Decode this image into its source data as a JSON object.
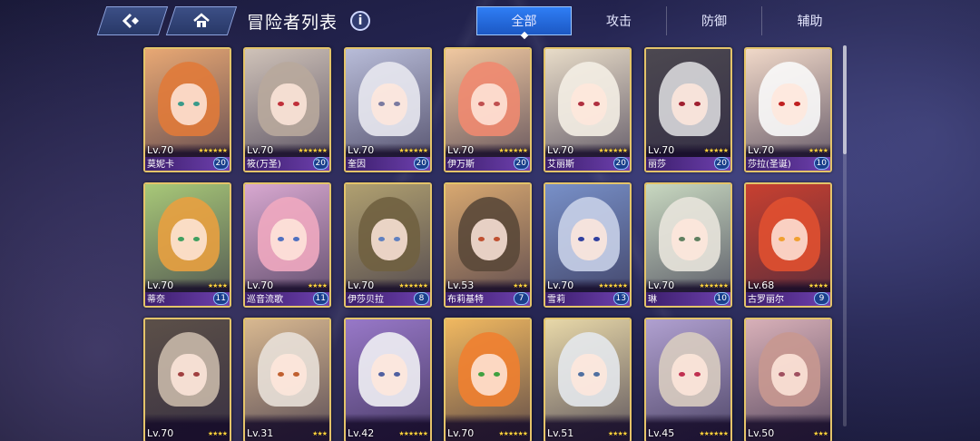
{
  "header": {
    "back_icon": "back-arrow-icon",
    "home_icon": "home-icon",
    "title": "冒险者列表",
    "info_label": "i"
  },
  "tabs": [
    {
      "label": "全部",
      "active": true
    },
    {
      "label": "攻击",
      "active": false
    },
    {
      "label": "防御",
      "active": false
    },
    {
      "label": "辅助",
      "active": false
    }
  ],
  "cards": [
    {
      "level": "Lv.70",
      "name": "莫妮卡",
      "badge": "20",
      "stars": 6,
      "bg": "#e8a874",
      "hair": "#e07a3a",
      "eye": "#3a9a8a"
    },
    {
      "level": "Lv.70",
      "name": "筱(万圣)",
      "badge": "20",
      "stars": 6,
      "bg": "#cfc2b8",
      "hair": "#b8a89c",
      "eye": "#c0303a"
    },
    {
      "level": "Lv.70",
      "name": "奎因",
      "badge": "20",
      "stars": 6,
      "bg": "#b8bcd8",
      "hair": "#e8e8f0",
      "eye": "#7a7aa0"
    },
    {
      "level": "Lv.70",
      "name": "伊万斯",
      "badge": "20",
      "stars": 6,
      "bg": "#f0c8a0",
      "hair": "#ef8a70",
      "eye": "#c05050"
    },
    {
      "level": "Lv.70",
      "name": "艾丽斯",
      "badge": "20",
      "stars": 6,
      "bg": "#e8dcc8",
      "hair": "#f4eee4",
      "eye": "#b03040"
    },
    {
      "level": "Lv.70",
      "name": "丽莎",
      "badge": "20",
      "stars": 5,
      "bg": "#4c4850",
      "hair": "#d8d8dc",
      "eye": "#a02030"
    },
    {
      "level": "Lv.70",
      "name": "莎拉(圣诞)",
      "badge": "10",
      "stars": 4,
      "bg": "#f0d8c8",
      "hair": "#fafafa",
      "eye": "#c02020"
    },
    {
      "level": "Lv.70",
      "name": "蒂奈",
      "badge": "11",
      "stars": 4,
      "bg": "#a8c878",
      "hair": "#e8a040",
      "eye": "#40a060"
    },
    {
      "level": "Lv.70",
      "name": "巡音流歌",
      "badge": "11",
      "stars": 4,
      "bg": "#d8a8d0",
      "hair": "#f0a8c0",
      "eye": "#5070c0"
    },
    {
      "level": "Lv.70",
      "name": "伊莎贝拉",
      "badge": "8",
      "stars": 6,
      "bg": "#b0a070",
      "hair": "#706040",
      "eye": "#6080c0"
    },
    {
      "level": "Lv.53",
      "name": "布莉基特",
      "badge": "7",
      "stars": 3,
      "bg": "#d8a870",
      "hair": "#5a4838",
      "eye": "#c05030"
    },
    {
      "level": "Lv.70",
      "name": "雪莉",
      "badge": "13",
      "stars": 6,
      "bg": "#7890c8",
      "hair": "#c8d0e8",
      "eye": "#3040a0"
    },
    {
      "level": "Lv.70",
      "name": "琳",
      "badge": "10",
      "stars": 6,
      "bg": "#c8d8c0",
      "hair": "#e8e4dc",
      "eye": "#608060"
    },
    {
      "level": "Lv.68",
      "name": "古罗丽尔",
      "badge": "9",
      "stars": 4,
      "bg": "#c84030",
      "hair": "#e05030",
      "eye": "#f0a030"
    },
    {
      "level": "Lv.70",
      "name": "",
      "badge": "",
      "stars": 4,
      "bg": "#5c5048",
      "hair": "#c8b8a8",
      "eye": "#a04040"
    },
    {
      "level": "Lv.31",
      "name": "",
      "badge": "",
      "stars": 3,
      "bg": "#d8b890",
      "hair": "#e8e0d8",
      "eye": "#c06030"
    },
    {
      "level": "Lv.42",
      "name": "",
      "badge": "",
      "stars": 6,
      "bg": "#9878c8",
      "hair": "#f0f0f4",
      "eye": "#5060a0"
    },
    {
      "level": "Lv.70",
      "name": "",
      "badge": "",
      "stars": 6,
      "bg": "#f0b860",
      "hair": "#f08030",
      "eye": "#40a040"
    },
    {
      "level": "Lv.51",
      "name": "",
      "badge": "",
      "stars": 4,
      "bg": "#e8d8a8",
      "hair": "#e4e8ec",
      "eye": "#5070a0"
    },
    {
      "level": "Lv.45",
      "name": "",
      "badge": "",
      "stars": 6,
      "bg": "#b0a0d0",
      "hair": "#d8ccc0",
      "eye": "#c03050"
    },
    {
      "level": "Lv.50",
      "name": "",
      "badge": "",
      "stars": 3,
      "bg": "#d8b0b8",
      "hair": "#c89890",
      "eye": "#a05060"
    }
  ],
  "scroll": {
    "position": 0
  }
}
